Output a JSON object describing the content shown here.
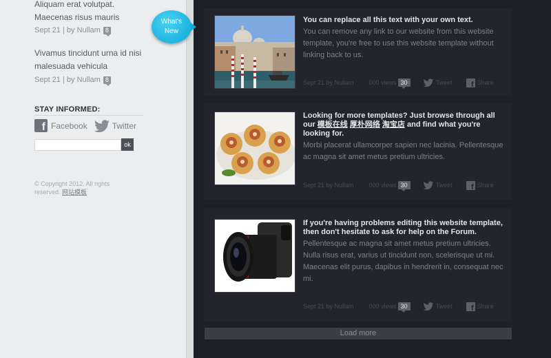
{
  "sidebar": {
    "items": [
      {
        "text": "Aliquam erat volutpat. Maecenas risus mauris",
        "date": "Sept 21",
        "sep": "|",
        "by": "by Nullam",
        "comments": "8"
      },
      {
        "text": "Vivamus tincidunt urna id nisi malesuada vehicula",
        "date": "Sept 21",
        "sep": "|",
        "by": "by Nullam",
        "comments": "8"
      }
    ],
    "stay_informed": "STAY INFORMED:",
    "facebook_label": "Facebook",
    "twitter_label": "Twitter",
    "search": {
      "value": "",
      "button": "ok"
    },
    "copyright": "© Copyright 2012. All rights reserved.",
    "copyright_link": "网站模板"
  },
  "badge": {
    "line1": "What's",
    "line2": "New"
  },
  "posts": [
    {
      "title": "You can replace all this text with your own text.",
      "text": "You can remove any link to our website from this website template, you're free to use this website template without linking back to us.",
      "image": "venice",
      "meta": {
        "date_by": "Sept 21 by Nullam",
        "views": "000 views",
        "count": "30",
        "tweet": "Tweet",
        "share": "Share"
      }
    },
    {
      "title_part1": "Looking for more templates? Just browse through all our",
      "link1": "模板在线",
      "link2": "厚朴网络",
      "link3": "淘宝店",
      "title_part2": "and find what you're looking for.",
      "text": "Morbi placerat ullamcorper sapien nec lacinia. Pellentesque ac magna sit amet metus pretium ultricies.",
      "image": "pastries",
      "meta": {
        "date_by": "Sept 21 by Nullam",
        "views": "000 views",
        "count": "30",
        "tweet": "Tweet",
        "share": "Share"
      }
    },
    {
      "title": "If you're having problems editing this website template, then don't hesitate to ask for help on the Forum.",
      "text": "Pellentesque ac magna sit amet metus pretium ultricies. Nulla risus erat, varius ut tincidunt non, scelerisque ut mi. Maecenas elit purus, dapibus in hendrerit in, consequat nec mi.",
      "image": "camera-lens",
      "meta": {
        "date_by": "Sept 21 by Nullam",
        "views": "000 views",
        "count": "30",
        "tweet": "Tweet",
        "share": "Share"
      }
    }
  ],
  "load_more": "Load more",
  "colors": {
    "accent": "#13a9d8",
    "content_bg": "#1e1f27",
    "sidebar_bg": "#ecedee"
  }
}
